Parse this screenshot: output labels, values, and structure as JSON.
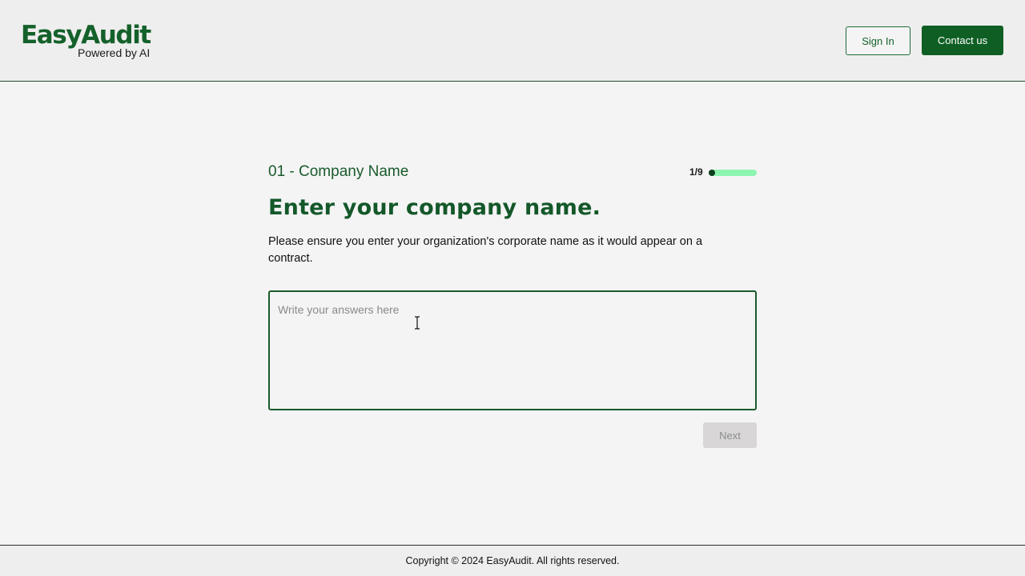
{
  "header": {
    "logo": {
      "name": "EasyAudit",
      "tagline": "Powered by AI"
    },
    "sign_in_label": "Sign In",
    "contact_label": "Contact us"
  },
  "step": {
    "label": "01 - Company Name",
    "progress_text": "1/9",
    "current": 1,
    "total": 9
  },
  "question": {
    "title": "Enter your company name.",
    "description": "Please ensure you enter your organization's corporate name as it would appear on a contract.",
    "answer_value": "",
    "answer_placeholder": "Write your answers here"
  },
  "actions": {
    "next_label": "Next"
  },
  "footer": {
    "copyright": "Copyright © 2024 EasyAudit. All rights reserved."
  },
  "colors": {
    "brand_green": "#14612b",
    "dark_green": "#0f5f24",
    "progress_track": "#8ef5b0",
    "disabled_button": "#d8d6d6"
  },
  "icons": {
    "cursor": "text-cursor-icon"
  }
}
